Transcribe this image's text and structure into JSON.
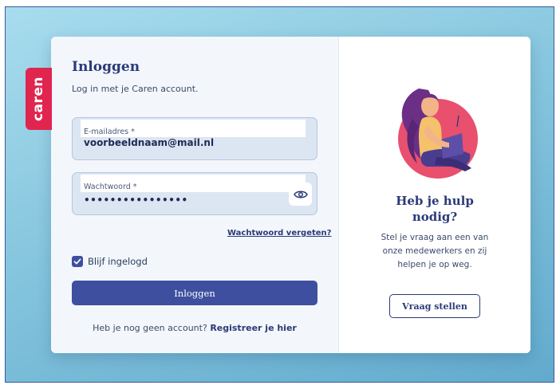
{
  "brand": {
    "name": "caren"
  },
  "login": {
    "title": "Inloggen",
    "subtitle": "Log in met je Caren account.",
    "email": {
      "label": "E-mailadres *",
      "value": "voorbeeldnaam@mail.nl"
    },
    "password": {
      "label": "Wachtwoord *",
      "value": "••••••••••••••••"
    },
    "forgot_link": "Wachtwoord vergeten?",
    "remember": {
      "label": "Blijf ingelogd",
      "checked": true
    },
    "submit_label": "Inloggen",
    "register_prompt": "Heb je nog geen account?",
    "register_link": "Registreer je hier"
  },
  "help": {
    "title_line1": "Heb je hulp",
    "title_line2": "nodig?",
    "text_line1": "Stel je vraag aan een van",
    "text_line2": "onze medewerkers en zij",
    "text_line3": "helpen je op weg.",
    "button_label": "Vraag stellen"
  },
  "icons": {
    "password_toggle": "eye-icon",
    "checkbox": "checkmark-icon"
  },
  "colors": {
    "brand_red": "#e0254f",
    "primary": "#3f4fa0",
    "heading": "#2b3a78"
  }
}
